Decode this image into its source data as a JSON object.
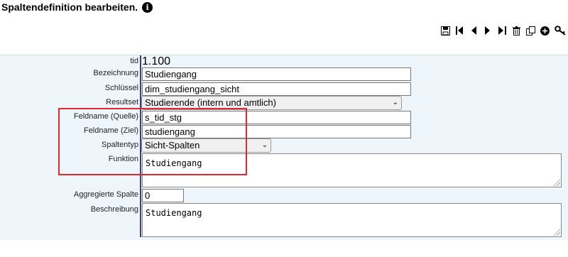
{
  "header": {
    "title": "Spaltendefinition bearbeiten."
  },
  "toolbar": {
    "icons": [
      "save-icon",
      "first-icon",
      "prev-icon",
      "next-icon",
      "last-icon",
      "delete-icon",
      "copy-icon",
      "add-icon",
      "key-icon"
    ]
  },
  "form": {
    "tid": {
      "label": "tid",
      "value": "1.100"
    },
    "bezeichnung": {
      "label": "Bezeichnung",
      "value": "Studiengang"
    },
    "schluessel": {
      "label": "Schlüssel",
      "value": "dim_studiengang_sicht"
    },
    "resultset": {
      "label": "Resultset",
      "value": "Studierende (intern und amtlich)"
    },
    "feldname_quelle": {
      "label": "Feldname (Quelle)",
      "value": "s_tid_stg"
    },
    "feldname_ziel": {
      "label": "Feldname (Ziel)",
      "value": "studiengang"
    },
    "spaltentyp": {
      "label": "Spaltentyp",
      "value": "Sicht-Spalten"
    },
    "funktion": {
      "label": "Funktion",
      "value": "Studiengang"
    },
    "aggregierte_spalte": {
      "label": "Aggregierte Spalte",
      "value": "0"
    },
    "beschreibung": {
      "label": "Beschreibung",
      "value": "Studiengang"
    }
  },
  "colors": {
    "panel_bg": "#eef5fb",
    "highlight_box": "#e0282e",
    "divider": "#3a3a9a"
  }
}
